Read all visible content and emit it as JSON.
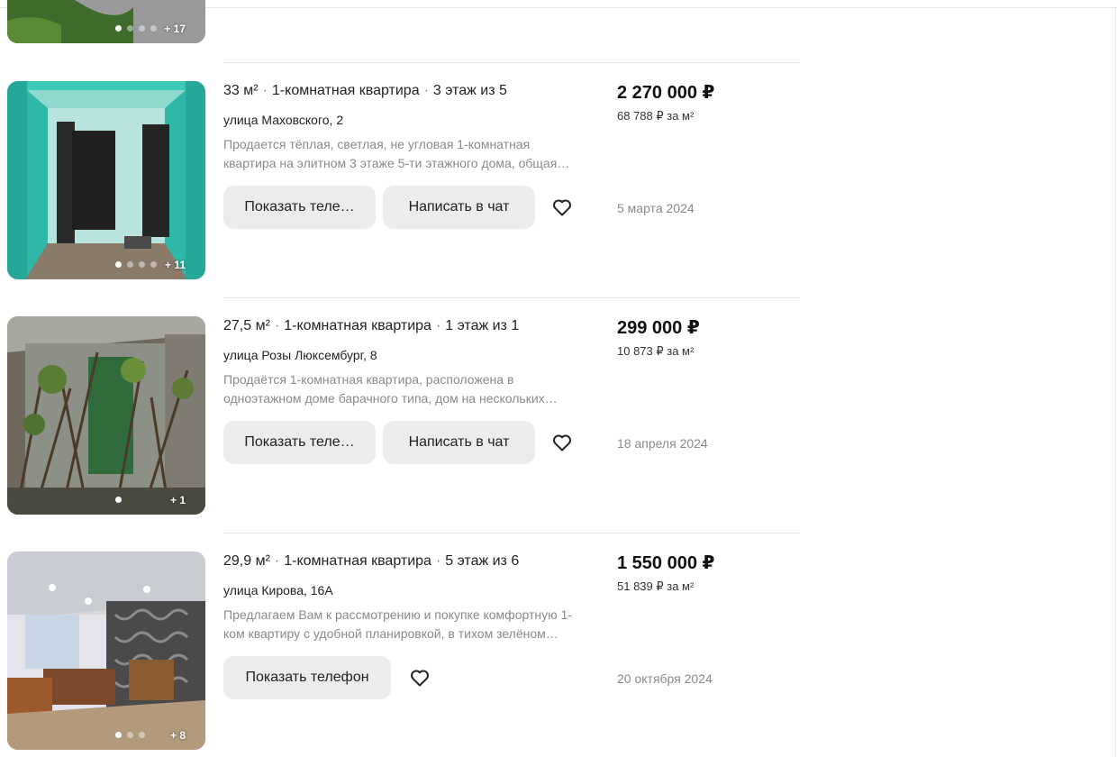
{
  "top_fragment": {
    "more_photos": "+ 17"
  },
  "listings": [
    {
      "area": "33 м²",
      "type": "1-комнатная квартира",
      "floor": "3 этаж из 5",
      "address": "улица Маховского, 2",
      "desc_line1": "Продается тёплая, светлая, не угловая 1-комнатная",
      "desc_line2": "квартира на элитном 3 этаже 5-ти этажного дома, общая…",
      "phone_btn": "Показать теле…",
      "chat_btn": "Написать в чат",
      "price": "2 270 000 ₽",
      "price_per_m2": "68 788 ₽ за м²",
      "date": "5 марта 2024",
      "more_photos": "+ 11"
    },
    {
      "area": "27,5 м²",
      "type": "1-комнатная квартира",
      "floor": "1 этаж из 1",
      "address": "улица Розы Люксембург, 8",
      "desc_line1": "Продаётся 1-комнатная квартира, расположена в",
      "desc_line2": "одноэтажном доме барачного типа, дом на нескольких…",
      "phone_btn": "Показать теле…",
      "chat_btn": "Написать в чат",
      "price": "299 000 ₽",
      "price_per_m2": "10 873 ₽ за м²",
      "date": "18 апреля 2024",
      "more_photos": "+ 1"
    },
    {
      "area": "29,9 м²",
      "type": "1-комнатная квартира",
      "floor": "5 этаж из 6",
      "address": "улица Кирова, 16А",
      "desc_line1": "Предлагаем Вам к рассмотрению и покупке комфортную 1-",
      "desc_line2": "ком квартиру с удобной планировкой, в тихом зелёном…",
      "phone_btn": "Показать телефон",
      "price": "1 550 000 ₽",
      "price_per_m2": "51 839 ₽ за м²",
      "date": "20 октября 2024",
      "more_photos": "+ 8"
    }
  ],
  "icons": {
    "favorite": "heart-outline-icon"
  }
}
